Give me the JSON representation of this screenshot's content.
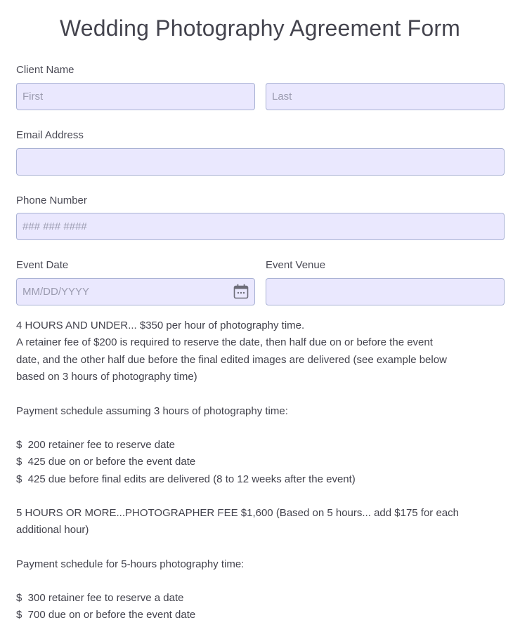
{
  "form": {
    "title": "Wedding Photography Agreement Form",
    "client_name": {
      "label": "Client Name",
      "first_placeholder": "First",
      "last_placeholder": "Last"
    },
    "email": {
      "label": "Email Address",
      "value": ""
    },
    "phone": {
      "label": "Phone Number",
      "placeholder": "### ### ####"
    },
    "event_date": {
      "label": "Event Date",
      "placeholder": "MM/DD/YYYY",
      "icon": "calendar-icon"
    },
    "event_venue": {
      "label": "Event Venue",
      "value": ""
    }
  },
  "terms": {
    "p1": [
      "4 HOURS AND UNDER... $350 per hour of photography time.",
      "A retainer fee of $200 is required to reserve the date, then half due on or before the event",
      "date, and the other half due before the final edited images are delivered (see example below",
      "based on 3 hours of photography time)"
    ],
    "schedule1_heading": "Payment schedule assuming 3 hours of photography time:",
    "schedule1": [
      "$  200 retainer fee to reserve date",
      "$  425 due on or before the event date",
      "$  425 due before final edits are delivered (8 to 12 weeks after the event)"
    ],
    "p2": [
      "5 HOURS OR MORE...PHOTOGRAPHER FEE $1,600 (Based on 5 hours... add $175 for each",
      "additional hour)"
    ],
    "schedule2_heading": "Payment schedule for 5-hours photography time:",
    "schedule2": [
      "$  300 retainer fee to reserve a date",
      "$  700 due on or before the event date"
    ]
  },
  "colors": {
    "field_bg": "#eae8fe",
    "field_border": "#a9b2d4",
    "text": "#42424c"
  }
}
